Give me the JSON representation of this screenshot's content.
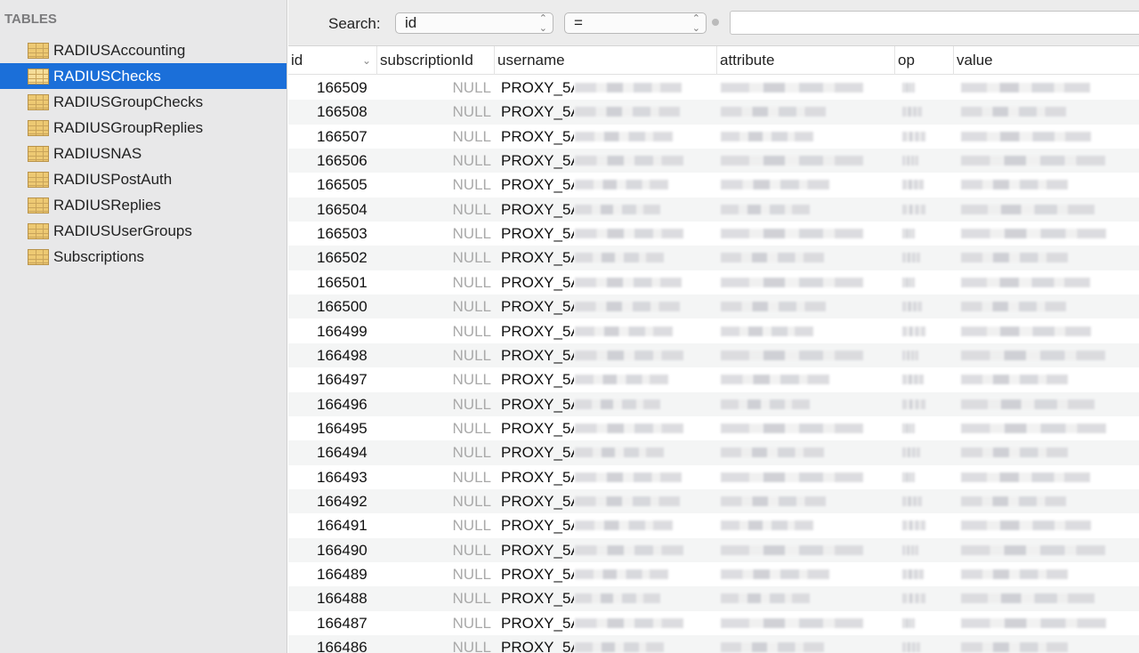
{
  "sidebar": {
    "section_title": "TABLES",
    "items": [
      {
        "label": "RADIUSAccounting",
        "selected": false
      },
      {
        "label": "RADIUSChecks",
        "selected": true
      },
      {
        "label": "RADIUSGroupChecks",
        "selected": false
      },
      {
        "label": "RADIUSGroupReplies",
        "selected": false
      },
      {
        "label": "RADIUSNAS",
        "selected": false
      },
      {
        "label": "RADIUSPostAuth",
        "selected": false
      },
      {
        "label": "RADIUSReplies",
        "selected": false
      },
      {
        "label": "RADIUSUserGroups",
        "selected": false
      },
      {
        "label": "Subscriptions",
        "selected": false
      }
    ]
  },
  "toolbar": {
    "search_label": "Search:",
    "field_value": "id",
    "operator_value": "=",
    "search_value": ""
  },
  "table": {
    "columns": [
      "id",
      "subscriptionId",
      "username",
      "attribute",
      "op",
      "value"
    ],
    "sort_column": "id",
    "sort_direction": "descending",
    "rows": [
      {
        "id": "166509",
        "subscriptionId": "NULL",
        "username": "PROXY_5A"
      },
      {
        "id": "166508",
        "subscriptionId": "NULL",
        "username": "PROXY_5A"
      },
      {
        "id": "166507",
        "subscriptionId": "NULL",
        "username": "PROXY_5A"
      },
      {
        "id": "166506",
        "subscriptionId": "NULL",
        "username": "PROXY_5A"
      },
      {
        "id": "166505",
        "subscriptionId": "NULL",
        "username": "PROXY_5A"
      },
      {
        "id": "166504",
        "subscriptionId": "NULL",
        "username": "PROXY_5A"
      },
      {
        "id": "166503",
        "subscriptionId": "NULL",
        "username": "PROXY_5A"
      },
      {
        "id": "166502",
        "subscriptionId": "NULL",
        "username": "PROXY_5A"
      },
      {
        "id": "166501",
        "subscriptionId": "NULL",
        "username": "PROXY_5A"
      },
      {
        "id": "166500",
        "subscriptionId": "NULL",
        "username": "PROXY_5A"
      },
      {
        "id": "166499",
        "subscriptionId": "NULL",
        "username": "PROXY_5A"
      },
      {
        "id": "166498",
        "subscriptionId": "NULL",
        "username": "PROXY_5A"
      },
      {
        "id": "166497",
        "subscriptionId": "NULL",
        "username": "PROXY_5A"
      },
      {
        "id": "166496",
        "subscriptionId": "NULL",
        "username": "PROXY_5A"
      },
      {
        "id": "166495",
        "subscriptionId": "NULL",
        "username": "PROXY_5A"
      },
      {
        "id": "166494",
        "subscriptionId": "NULL",
        "username": "PROXY_5A"
      },
      {
        "id": "166493",
        "subscriptionId": "NULL",
        "username": "PROXY_5A"
      },
      {
        "id": "166492",
        "subscriptionId": "NULL",
        "username": "PROXY_5A"
      },
      {
        "id": "166491",
        "subscriptionId": "NULL",
        "username": "PROXY_5A"
      },
      {
        "id": "166490",
        "subscriptionId": "NULL",
        "username": "PROXY_5A"
      },
      {
        "id": "166489",
        "subscriptionId": "NULL",
        "username": "PROXY_5A"
      },
      {
        "id": "166488",
        "subscriptionId": "NULL",
        "username": "PROXY_5A"
      },
      {
        "id": "166487",
        "subscriptionId": "NULL",
        "username": "PROXY_5A"
      },
      {
        "id": "166486",
        "subscriptionId": "NULL",
        "username": "PROXY_5A"
      }
    ]
  },
  "colors": {
    "selection": "#1b6fd9",
    "sidebar_bg": "#e8e8e9",
    "null_text": "#a9a9a9"
  }
}
